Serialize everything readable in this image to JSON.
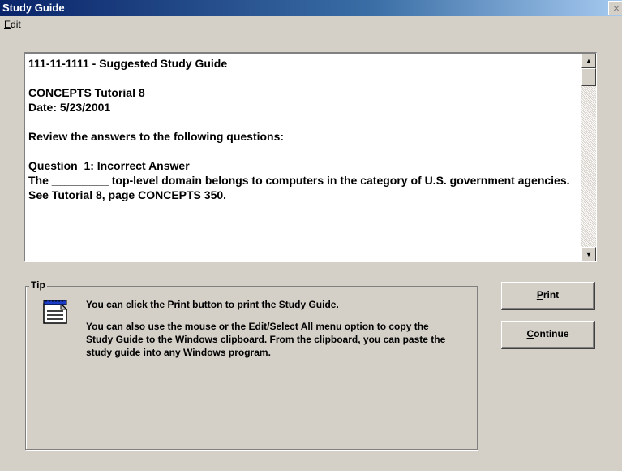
{
  "window": {
    "title": "Study Guide",
    "close_glyph": "×"
  },
  "menu": {
    "edit_mnemonic": "E",
    "edit_rest": "dit"
  },
  "guide": {
    "header": "111-11-1111 - Suggested Study Guide",
    "tutorial": "CONCEPTS Tutorial 8",
    "date": "Date: 5/23/2001",
    "instruction": "Review the answers to the following questions:",
    "question_title": "Question  1: Incorrect Answer",
    "question_text": "The _________ top-level domain belongs to computers in the category of U.S. government agencies.",
    "reference": "See Tutorial 8, page CONCEPTS 350."
  },
  "tip": {
    "legend": "Tip",
    "icon": "notepad-icon",
    "line1": "You can click the Print button to print the Study Guide.",
    "line2": "You can also use the mouse or the Edit/Select All menu option to copy the Study Guide to the Windows clipboard. From the clipboard, you can paste the study guide into any Windows program."
  },
  "buttons": {
    "print_mnemonic": "P",
    "print_rest": "rint",
    "continue_mnemonic": "C",
    "continue_rest": "ontinue"
  },
  "colors": {
    "titlebar_start": "#0a246a",
    "titlebar_end": "#a6caf0",
    "face": "#d4d0c8"
  }
}
